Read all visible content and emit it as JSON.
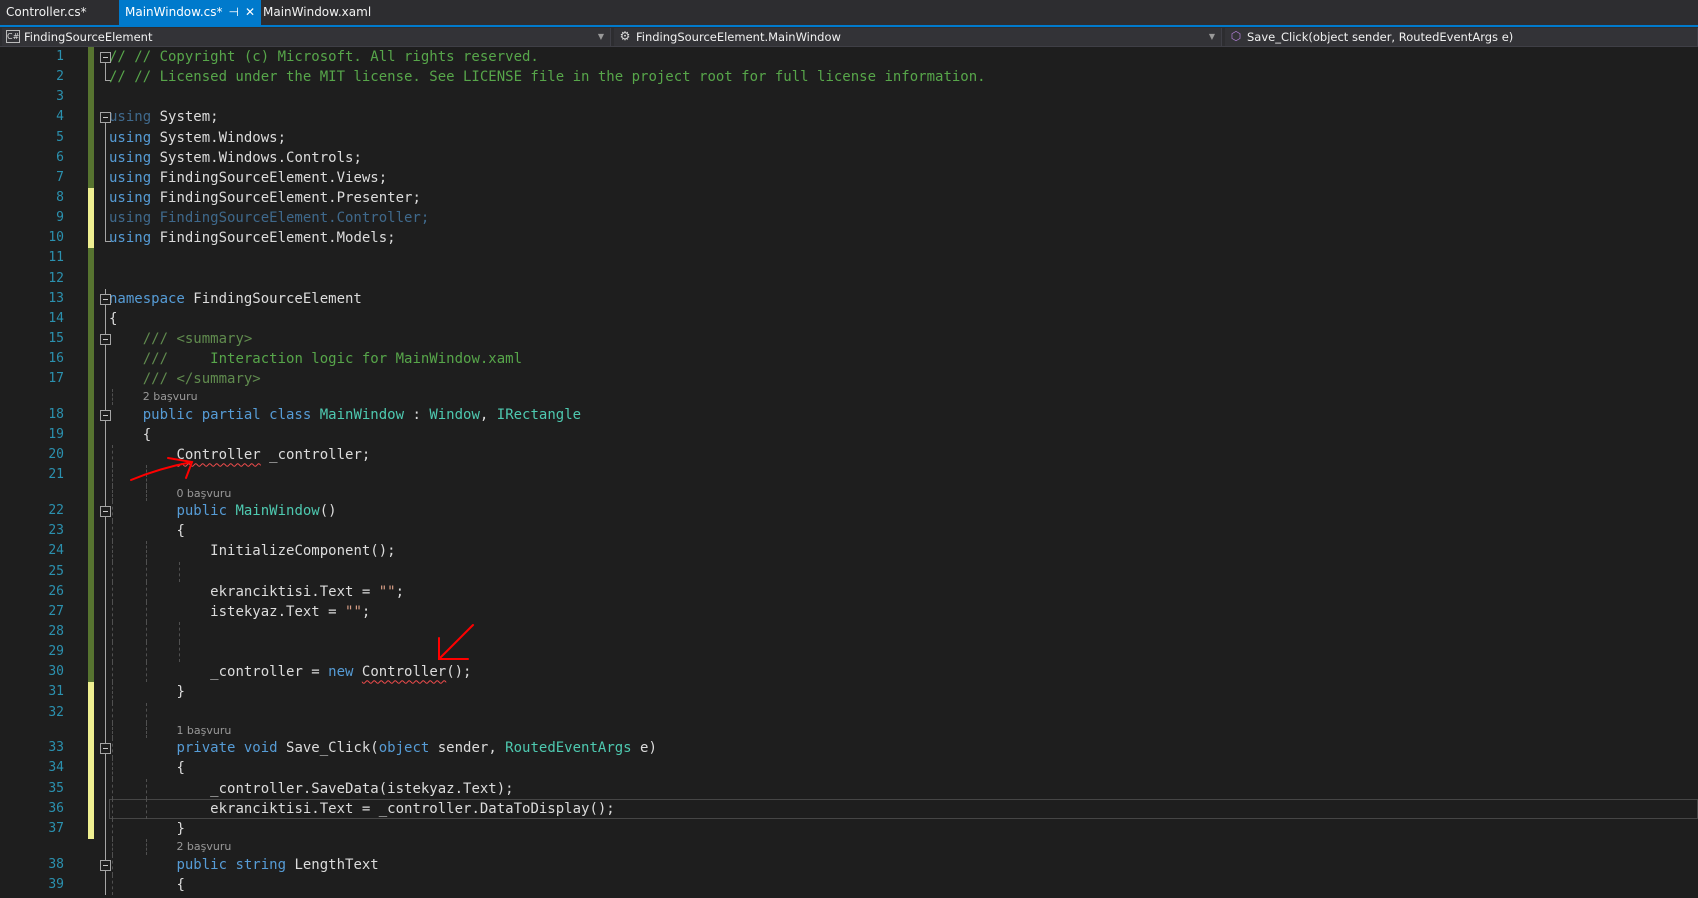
{
  "tabs": [
    {
      "label": "Controller.cs*",
      "active": false
    },
    {
      "label": "MainWindow.cs*",
      "active": true,
      "pin": "⊣",
      "close": "✕"
    },
    {
      "label": "MainWindow.xaml",
      "active": false
    }
  ],
  "nav": {
    "project": {
      "icon": "C#",
      "label": "FindingSourceElement"
    },
    "type": {
      "label": "FindingSourceElement.MainWindow"
    },
    "member": {
      "label": "Save_Click(object sender, RoutedEventArgs e)"
    }
  },
  "colors": {
    "accent": "#007acc",
    "change_saved": "#577430",
    "change_unsaved": "#efef91",
    "squiggle": "#f14c4c",
    "annotation": "#ff0000"
  },
  "current_line": 36,
  "lines": [
    {
      "n": "1",
      "chg": "green",
      "fold": "open",
      "ind": 0,
      "tk": [
        [
          "// // Copyright (c) Microsoft. All rights reserved.",
          "c"
        ]
      ]
    },
    {
      "n": "2",
      "chg": "green",
      "fold": "end",
      "ind": 0,
      "tk": [
        [
          "// // Licensed under the MIT license. See LICENSE file in the project root for full license information.",
          "c"
        ]
      ]
    },
    {
      "n": "3",
      "chg": "green",
      "fold": "",
      "ind": 0,
      "tk": []
    },
    {
      "n": "4",
      "chg": "green",
      "fold": "open",
      "ind": 0,
      "tk": [
        [
          "using",
          "k dim"
        ],
        [
          " System;",
          "p"
        ]
      ]
    },
    {
      "n": "5",
      "chg": "green",
      "fold": "line",
      "ind": 0,
      "tk": [
        [
          "using",
          "k"
        ],
        [
          " System.Windows;",
          "p"
        ]
      ]
    },
    {
      "n": "6",
      "chg": "green",
      "fold": "line",
      "ind": 0,
      "tk": [
        [
          "using",
          "k"
        ],
        [
          " System.Windows.Controls;",
          "p"
        ]
      ]
    },
    {
      "n": "7",
      "chg": "green",
      "fold": "line",
      "ind": 0,
      "tk": [
        [
          "using",
          "k"
        ],
        [
          " FindingSourceElement.Views;",
          "p"
        ]
      ]
    },
    {
      "n": "8",
      "chg": "yellow",
      "fold": "line",
      "ind": 0,
      "tk": [
        [
          "using",
          "k"
        ],
        [
          " FindingSourceElement.Presenter;",
          "p"
        ]
      ]
    },
    {
      "n": "9",
      "chg": "yellow",
      "fold": "line",
      "ind": 0,
      "tk": [
        [
          "using FindingSourceElement.Controller;",
          "k dim"
        ]
      ]
    },
    {
      "n": "10",
      "chg": "yellow",
      "fold": "end",
      "ind": 0,
      "tk": [
        [
          "using",
          "k"
        ],
        [
          " FindingSourceElement.Models;",
          "p"
        ]
      ]
    },
    {
      "n": "11",
      "chg": "green",
      "fold": "",
      "ind": 0,
      "tk": []
    },
    {
      "n": "12",
      "chg": "green",
      "fold": "",
      "ind": 0,
      "tk": []
    },
    {
      "n": "13",
      "chg": "green",
      "fold": "open",
      "ind": 0,
      "tk": [
        [
          "namespace",
          "k"
        ],
        [
          " FindingSourceElement",
          "p"
        ]
      ]
    },
    {
      "n": "14",
      "chg": "green",
      "fold": "line",
      "ind": 0,
      "tk": [
        [
          "{",
          "p"
        ]
      ]
    },
    {
      "n": "15",
      "chg": "green",
      "fold": "open",
      "ind": 1,
      "tk": [
        [
          "/// ",
          "d"
        ],
        [
          "<summary>",
          "d"
        ]
      ]
    },
    {
      "n": "16",
      "chg": "green",
      "fold": "line",
      "ind": 1,
      "tk": [
        [
          "///",
          "d"
        ],
        [
          "     Interaction logic for MainWindow.xaml",
          "c"
        ]
      ]
    },
    {
      "n": "17",
      "chg": "green",
      "fold": "line",
      "ind": 1,
      "tk": [
        [
          "/// ",
          "d"
        ],
        [
          "</summary>",
          "d"
        ]
      ]
    },
    {
      "lens": "2 başvuru",
      "ind": 1
    },
    {
      "n": "18",
      "chg": "green",
      "fold": "open",
      "ind": 1,
      "tk": [
        [
          "public partial class ",
          "k"
        ],
        [
          "MainWindow",
          "t"
        ],
        [
          " : ",
          "p"
        ],
        [
          "Window",
          "t"
        ],
        [
          ", ",
          "p"
        ],
        [
          "IRectangle",
          "t"
        ]
      ]
    },
    {
      "n": "19",
      "chg": "green",
      "fold": "line",
      "ind": 1,
      "tk": [
        [
          "{",
          "p"
        ]
      ]
    },
    {
      "n": "20",
      "chg": "green",
      "fold": "line",
      "ind": 2,
      "tk": [
        [
          "Controller",
          "p err"
        ],
        [
          " _controller;",
          "p"
        ]
      ]
    },
    {
      "n": "21",
      "chg": "green",
      "fold": "line",
      "ind": 0,
      "tk": []
    },
    {
      "lens": "0 başvuru",
      "ind": 2
    },
    {
      "n": "22",
      "chg": "green",
      "fold": "open",
      "ind": 2,
      "tk": [
        [
          "public ",
          "k"
        ],
        [
          "MainWindow",
          "t"
        ],
        [
          "()",
          "p"
        ]
      ]
    },
    {
      "n": "23",
      "chg": "green",
      "fold": "line",
      "ind": 2,
      "tk": [
        [
          "{",
          "p"
        ]
      ]
    },
    {
      "n": "24",
      "chg": "green",
      "fold": "line",
      "ind": 3,
      "tk": [
        [
          "InitializeComponent();",
          "p"
        ]
      ]
    },
    {
      "n": "25",
      "chg": "green",
      "fold": "line",
      "ind": 0,
      "tk": []
    },
    {
      "n": "26",
      "chg": "green",
      "fold": "line",
      "ind": 3,
      "tk": [
        [
          "ekranciktisi.Text = ",
          "p"
        ],
        [
          "\"\"",
          "s"
        ],
        [
          ";",
          "p"
        ]
      ]
    },
    {
      "n": "27",
      "chg": "green",
      "fold": "line",
      "ind": 3,
      "tk": [
        [
          "istekyaz.Text = ",
          "p"
        ],
        [
          "\"\"",
          "s"
        ],
        [
          ";",
          "p"
        ]
      ]
    },
    {
      "n": "28",
      "chg": "green",
      "fold": "line",
      "ind": 0,
      "tk": []
    },
    {
      "n": "29",
      "chg": "green",
      "fold": "line",
      "ind": 0,
      "tk": []
    },
    {
      "n": "30",
      "chg": "green",
      "fold": "line",
      "ind": 3,
      "tk": [
        [
          "_controller = ",
          "p"
        ],
        [
          "new ",
          "k"
        ],
        [
          "Controller",
          "p err"
        ],
        [
          "();",
          "p"
        ]
      ]
    },
    {
      "n": "31",
      "chg": "yellow",
      "fold": "line",
      "ind": 2,
      "tk": [
        [
          "}",
          "p"
        ]
      ]
    },
    {
      "n": "32",
      "chg": "yellow",
      "fold": "line",
      "ind": 0,
      "tk": []
    },
    {
      "lens": "1 başvuru",
      "ind": 2
    },
    {
      "n": "33",
      "chg": "yellow",
      "fold": "open",
      "ind": 2,
      "tk": [
        [
          "private void ",
          "k"
        ],
        [
          "Save_Click(",
          "p"
        ],
        [
          "object",
          "k"
        ],
        [
          " sender, ",
          "p"
        ],
        [
          "RoutedEventArgs",
          "t"
        ],
        [
          " e)",
          "p"
        ]
      ]
    },
    {
      "n": "34",
      "chg": "yellow",
      "fold": "line",
      "ind": 2,
      "tk": [
        [
          "{",
          "p"
        ]
      ]
    },
    {
      "n": "35",
      "chg": "yellow",
      "fold": "line",
      "ind": 3,
      "tk": [
        [
          "_controller.SaveData(istekyaz.Text);",
          "p"
        ]
      ]
    },
    {
      "n": "36",
      "chg": "yellow",
      "fold": "line",
      "ind": 3,
      "tk": [
        [
          "ekranciktisi.Text = _controller.DataToDisplay();",
          "p"
        ]
      ]
    },
    {
      "n": "37",
      "chg": "yellow",
      "fold": "line",
      "ind": 2,
      "tk": [
        [
          "}",
          "p"
        ]
      ]
    },
    {
      "lens": "2 başvuru",
      "ind": 2
    },
    {
      "n": "38",
      "chg": "",
      "fold": "open",
      "ind": 2,
      "tk": [
        [
          "public string ",
          "k"
        ],
        [
          "LengthText",
          "p"
        ]
      ]
    },
    {
      "n": "39",
      "chg": "",
      "fold": "line",
      "ind": 2,
      "tk": [
        [
          "{",
          "p"
        ]
      ]
    }
  ]
}
